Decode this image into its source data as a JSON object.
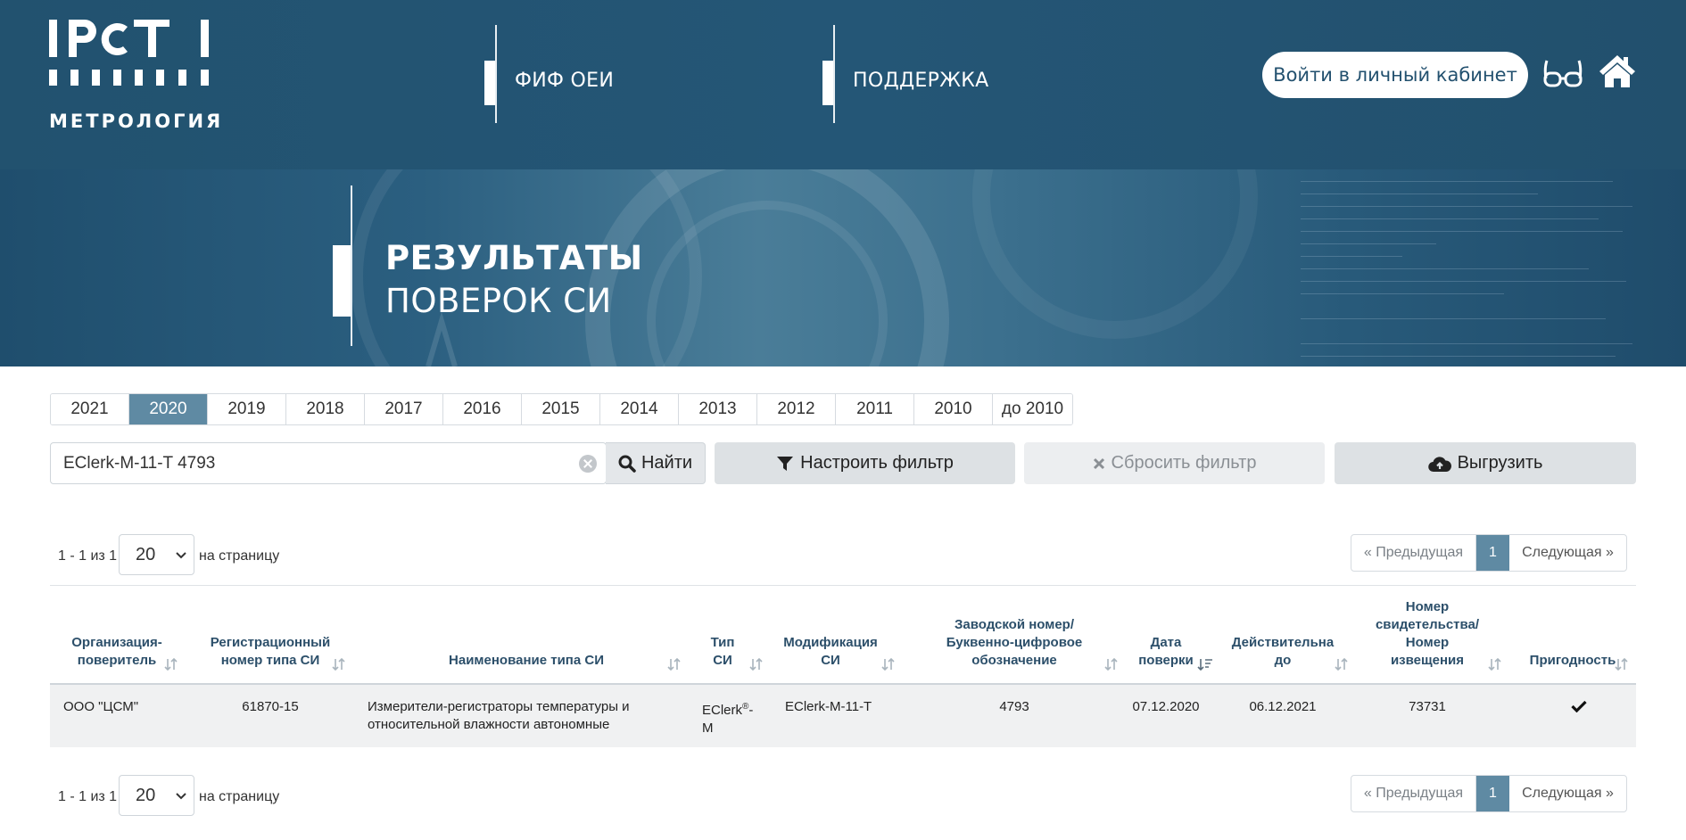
{
  "header": {
    "logo_text": "МЕТРОЛОГИЯ",
    "logo_icon": "rst-logo-icon",
    "nav": [
      {
        "label": "ФИФ ОЕИ"
      },
      {
        "label": "ПОДДЕРЖКА"
      }
    ],
    "login_label": "Войти в личный кабинет",
    "icons": [
      "glasses-icon",
      "home-icon"
    ]
  },
  "banner": {
    "title_line1": "РЕЗУЛЬТАТЫ",
    "title_line2": "ПОВЕРОК СИ"
  },
  "years": [
    {
      "label": "2021",
      "active": false
    },
    {
      "label": "2020",
      "active": true
    },
    {
      "label": "2019",
      "active": false
    },
    {
      "label": "2018",
      "active": false
    },
    {
      "label": "2017",
      "active": false
    },
    {
      "label": "2016",
      "active": false
    },
    {
      "label": "2015",
      "active": false
    },
    {
      "label": "2014",
      "active": false
    },
    {
      "label": "2013",
      "active": false
    },
    {
      "label": "2012",
      "active": false
    },
    {
      "label": "2011",
      "active": false
    },
    {
      "label": "2010",
      "active": false
    },
    {
      "label": "до 2010",
      "active": false
    }
  ],
  "search": {
    "value": "EClerk-M-11-T 4793",
    "find_label": "Найти"
  },
  "actions": {
    "filter_label": "Настроить фильтр",
    "reset_label": "Сбросить фильтр",
    "export_label": "Выгрузить"
  },
  "pager": {
    "info": "1 - 1 из 1",
    "per_page": "20",
    "per_page_label": "на страницу",
    "prev_label": "Предыдущая",
    "current_page": "1",
    "next_label": "Следующая"
  },
  "table": {
    "columns": [
      {
        "label1": "Организация-",
        "label2": "поверитель"
      },
      {
        "label1": "Регистрационный",
        "label2": "номер типа СИ"
      },
      {
        "label1": "Наименование типа СИ"
      },
      {
        "label1": "Тип",
        "label2": "СИ"
      },
      {
        "label1": "Модификация",
        "label2": "СИ"
      },
      {
        "label1": "Заводской номер/",
        "label2": "Буквенно-цифровое",
        "label3": "обозначение"
      },
      {
        "label1": "Дата",
        "label2": "поверки"
      },
      {
        "label1": "Действительна",
        "label2": "до"
      },
      {
        "label1": "Номер",
        "label2": "свидетельства/",
        "label3": "Номер",
        "label4": "извещения"
      },
      {
        "label1": "Пригодность"
      }
    ],
    "rows": [
      {
        "org": "ООО \"ЦСМ\"",
        "reg_number": "61870-15",
        "name_line1": "Измерители-регистраторы температуры и",
        "name_line2": "относительной влажности автономные",
        "type_line1": "EClerk",
        "type_sup": "®",
        "type_dash": "-",
        "type_line2": "M",
        "modification": "EClerk-M-11-T",
        "serial": "4793",
        "verify_date": "07.12.2020",
        "valid_until": "06.12.2021",
        "certificate": "73731",
        "suitability_icon": "check-icon"
      }
    ]
  }
}
